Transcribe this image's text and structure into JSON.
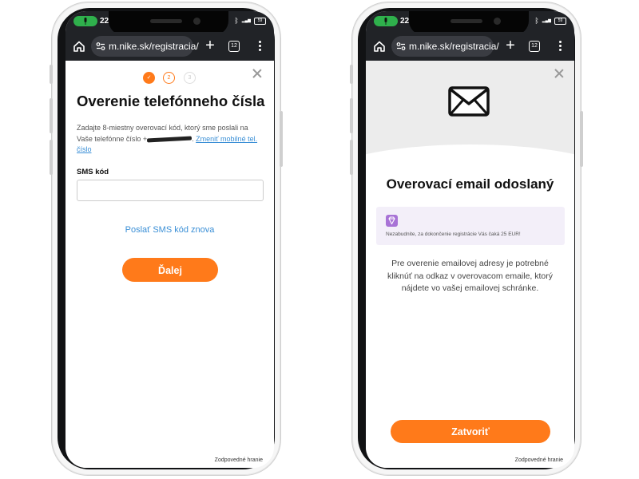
{
  "left_phone": {
    "status": {
      "time": "22:3",
      "signal_text": "22%",
      "battery": "59"
    },
    "browser": {
      "url": "m.nike.sk/registracia/",
      "tab_count": "12"
    },
    "steps": [
      {
        "label": "✓",
        "state": "done"
      },
      {
        "label": "2",
        "state": "active"
      },
      {
        "label": "3",
        "state": "inactive"
      }
    ],
    "heading": "Overenie telefónneho čísla",
    "description": "Zadajte 8-miestny overovací kód, ktorý sme poslali na Vaše telefónne číslo +",
    "change_link": "Zmeniť mobilné tel. číslo",
    "sms_label": "SMS kód",
    "sms_value": "",
    "resend_link": "Poslať SMS kód znova",
    "next_button": "Ďalej",
    "footer_link": "Zodpovedné hranie"
  },
  "right_phone": {
    "status": {
      "time": "22:",
      "signal_text": "22%",
      "battery": "59"
    },
    "browser": {
      "url": "m.nike.sk/registracia/",
      "tab_count": "12"
    },
    "heading": "Overovací email odoslaný",
    "promo_text": "Nezabudnite, za dokončenie registrácie Vás čaká 25 EUR!",
    "verify_text": "Pre overenie emailovej adresy je potrebné kliknúť na odkaz v overovacom emaile, ktorý nájdete vo vašej emailovej schránke.",
    "close_button": "Zatvoriť",
    "footer_link": "Zodpovedné hranie"
  },
  "colors": {
    "accent": "#ff7a1a",
    "link": "#3a8fd6",
    "toolbar": "#212327",
    "promo_bg": "#f3eff9",
    "gem": "#a873d6"
  },
  "icons": [
    "microphone-icon",
    "home-icon",
    "site-settings-icon",
    "plus-icon",
    "tabs-icon",
    "menu-icon",
    "close-icon",
    "envelope-icon",
    "gem-icon",
    "check-icon"
  ]
}
